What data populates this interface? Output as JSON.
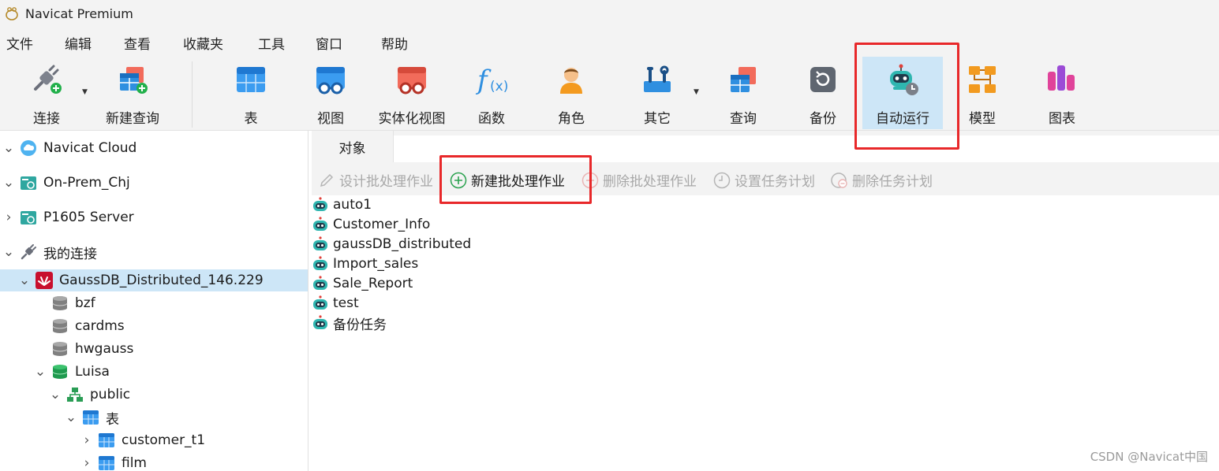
{
  "window": {
    "title": "Navicat Premium"
  },
  "menu": [
    "文件",
    "编辑",
    "查看",
    "收藏夹",
    "工具",
    "窗口",
    "帮助"
  ],
  "toolbar": {
    "connect": "连接",
    "new_query": "新建查询",
    "table": "表",
    "view": "视图",
    "materialized_view": "实体化视图",
    "function": "函数",
    "role": "角色",
    "other": "其它",
    "query": "查询",
    "backup": "备份",
    "automation": "自动运行",
    "model": "模型",
    "chart": "图表"
  },
  "sidebar": {
    "navicat_cloud": "Navicat Cloud",
    "on_prem": "On-Prem_Chj",
    "p1605": "P1605 Server",
    "my_connections": "我的连接",
    "gaussdb": "GaussDB_Distributed_146.229",
    "db_bzf": "bzf",
    "db_cardms": "cardms",
    "db_hwgauss": "hwgauss",
    "db_luisa": "Luisa",
    "schema_public": "public",
    "tables_group": "表",
    "table_customer": "customer_t1",
    "table_film": "film"
  },
  "tabs": {
    "objects": "对象"
  },
  "object_toolbar": {
    "design_batch": "设计批处理作业",
    "new_batch": "新建批处理作业",
    "delete_batch": "删除批处理作业",
    "set_schedule": "设置任务计划",
    "delete_schedule": "删除任务计划"
  },
  "jobs": [
    "auto1",
    "Customer_Info",
    "gaussDB_distributed",
    "Import_sales",
    "Sale_Report",
    "test",
    "备份任务"
  ],
  "watermark": "CSDN @Navicat中国",
  "colors": {
    "highlight": "#e8282a",
    "selection": "#cde6f7"
  }
}
